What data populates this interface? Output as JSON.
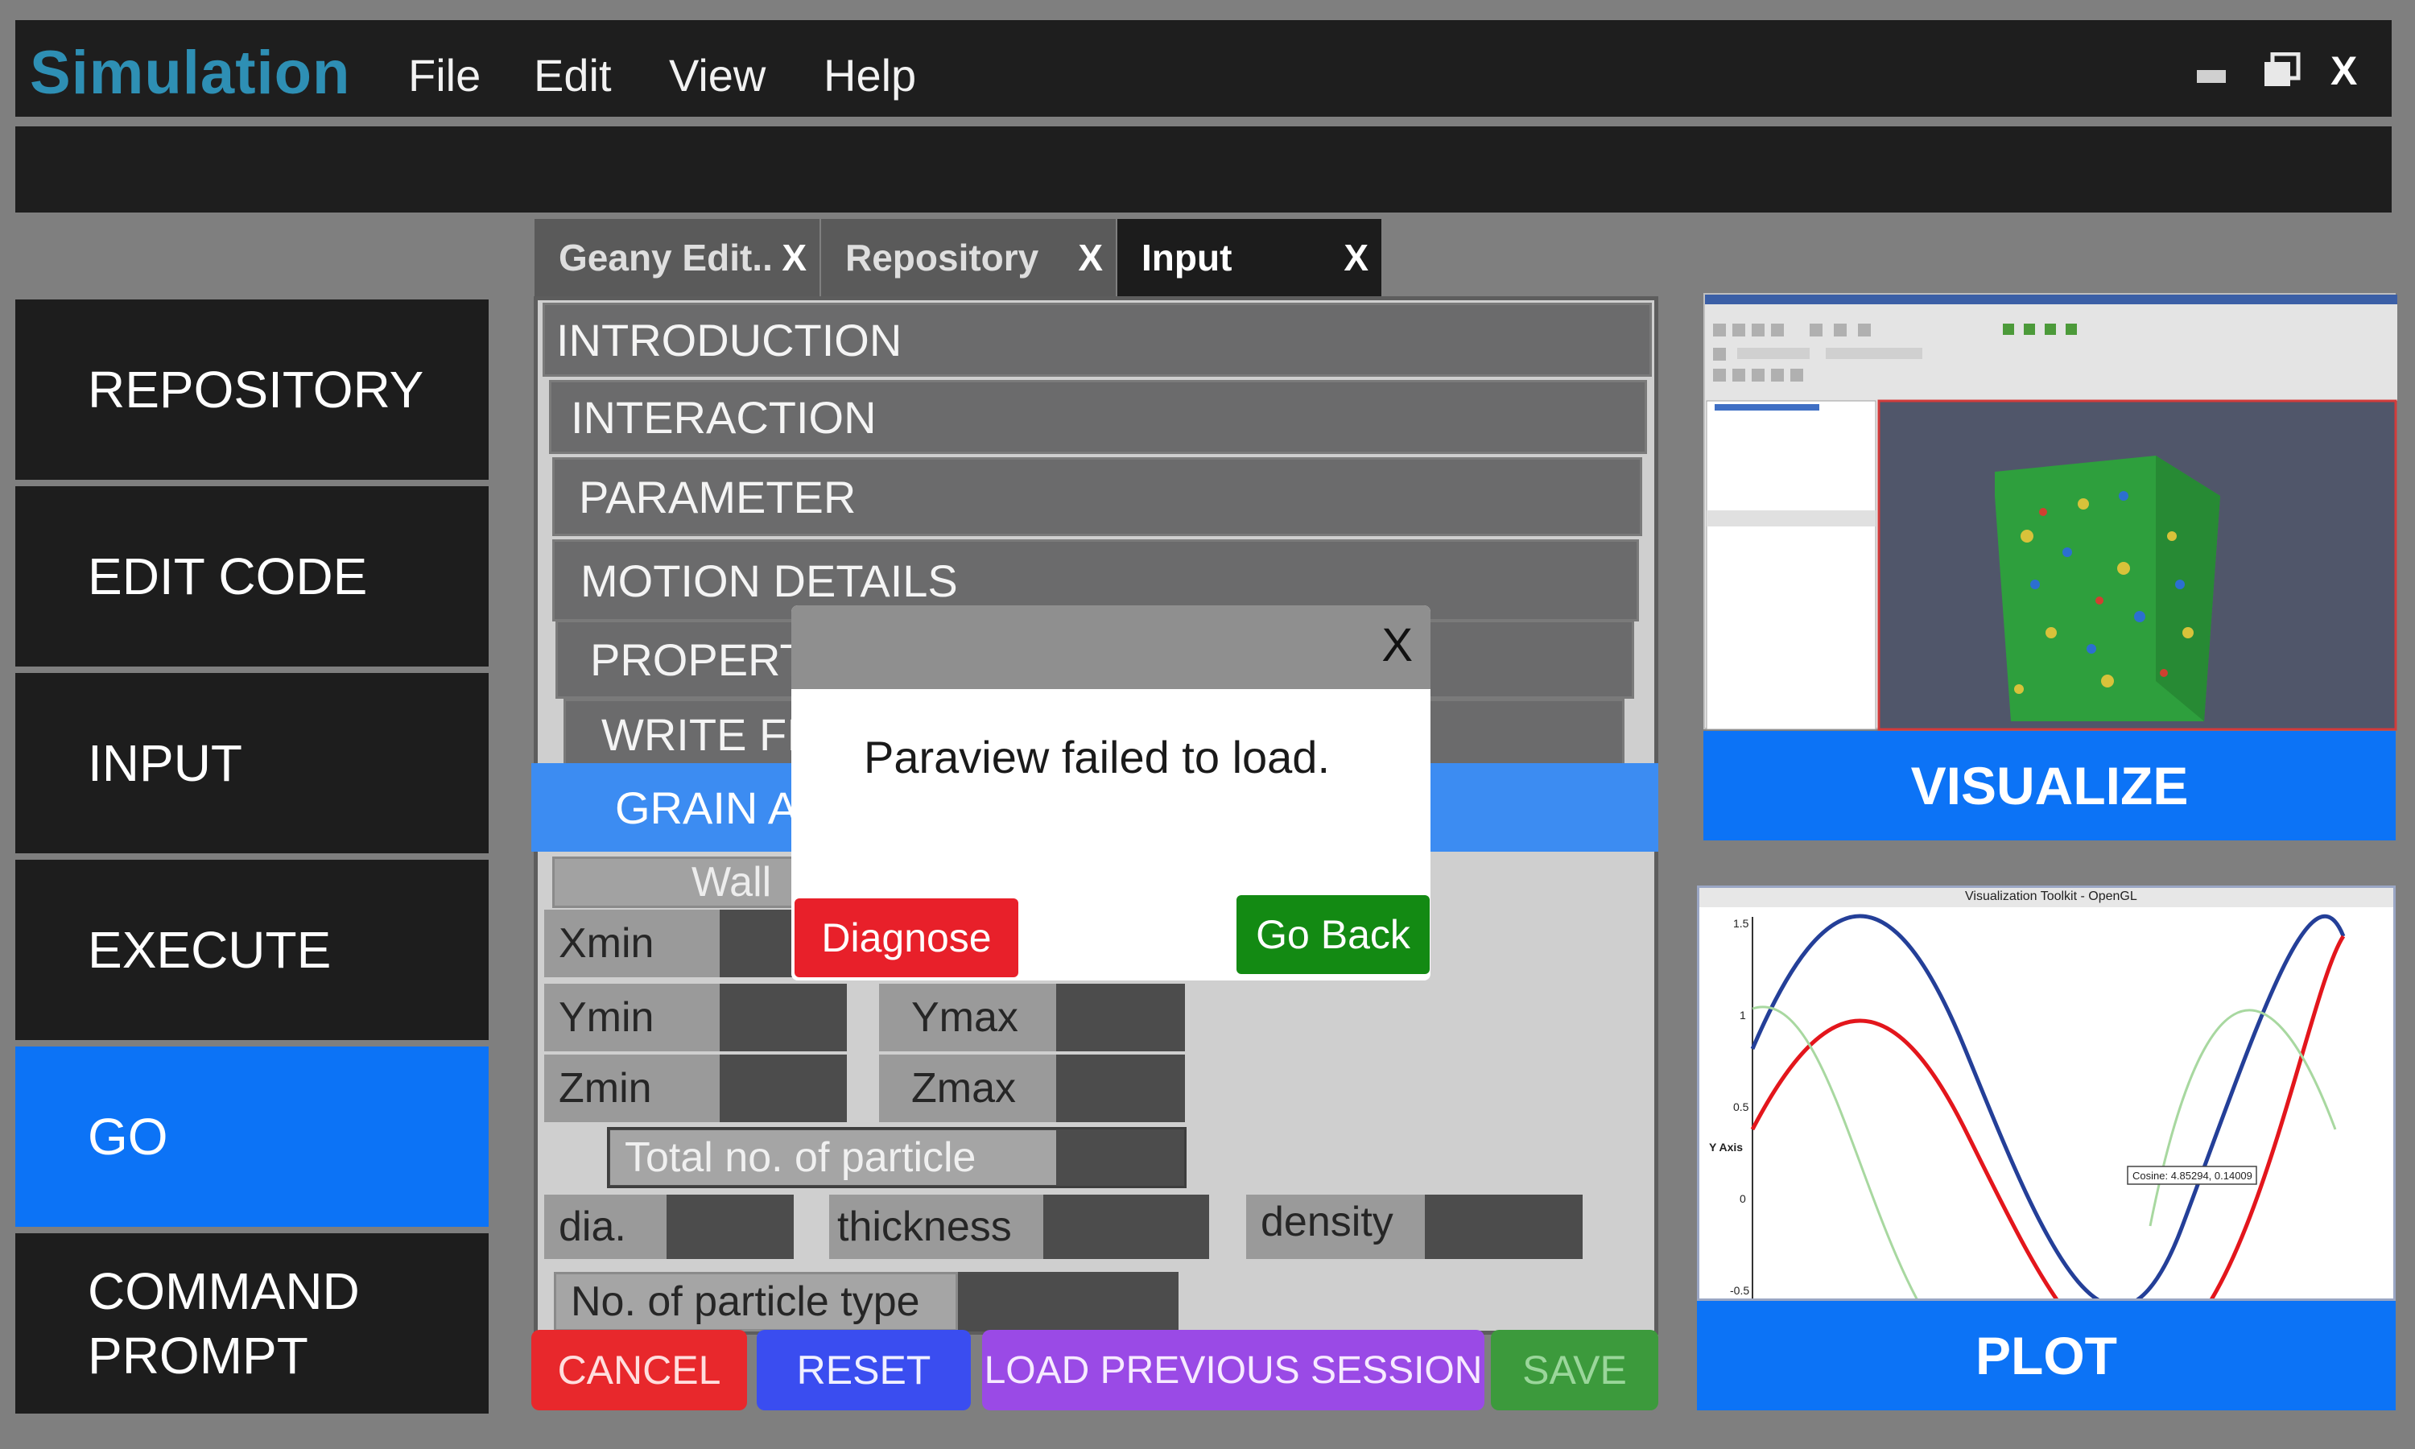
{
  "app": {
    "title": "Simulation",
    "menu": [
      "File",
      "Edit",
      "View",
      "Help"
    ],
    "window_controls": {
      "minimize": "▬",
      "maximize": "❐",
      "close": "X"
    }
  },
  "nav": {
    "items": [
      "REPOSITORY",
      "EDIT CODE",
      "INPUT",
      "EXECUTE",
      "GO",
      "COMMAND PROMPT"
    ],
    "active": "GO"
  },
  "tabs": [
    {
      "label": "Geany Edit..",
      "close": "X"
    },
    {
      "label": "Repository",
      "close": "X"
    },
    {
      "label": "Input",
      "close": "X"
    }
  ],
  "sections": [
    "INTRODUCTION",
    "INTERACTION",
    "PARAMETER",
    "MOTION DETAILS",
    "PROPERT",
    "WRITE FI",
    "GRAIN A"
  ],
  "fields": {
    "wall": "Wall",
    "xmin": "Xmin",
    "ymin": "Ymin",
    "ymax": "Ymax",
    "zmin": "Zmin",
    "zmax": "Zmax",
    "total": "Total no. of particle",
    "dia": "dia.",
    "thickness": "thickness",
    "density": "density",
    "ptype": "No. of particle type"
  },
  "buttons": {
    "cancel": "CANCEL",
    "reset": "RESET",
    "load": "LOAD PREVIOUS SESSION",
    "save": "SAVE"
  },
  "dialog": {
    "close": "X",
    "message": "Paraview failed to load.",
    "diagnose": "Diagnose",
    "go_back": "Go Back"
  },
  "visualize": {
    "label": "VISUALIZE"
  },
  "plot": {
    "label": "PLOT",
    "window_title": "Visualization Toolkit - OpenGL",
    "y_axis": "Y Axis",
    "y_ticks": [
      "1.5",
      "1",
      "0.5",
      "0",
      "-0.5"
    ],
    "tooltip": "Cosine: 4.85294, 0.14009"
  },
  "colors": {
    "accent_blue": "#0c73f6",
    "cancel_red": "#e8282c",
    "reset_blue": "#3a4df0",
    "load_purple": "#9a4ae6",
    "save_green": "#3c9a3c",
    "diagnose_red": "#e8202a",
    "goback_green": "#138a13"
  }
}
